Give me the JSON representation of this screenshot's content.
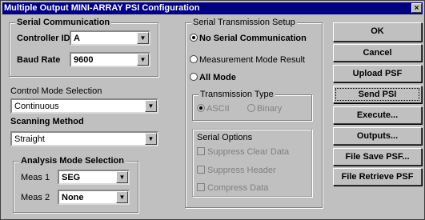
{
  "window": {
    "title": "Multiple Output MINI-ARRAY PSI Configuration",
    "close_glyph": "×"
  },
  "serial_comm": {
    "title": "Serial Communication",
    "controller_id_label": "Controller ID",
    "controller_id_value": "A",
    "baud_rate_label": "Baud Rate",
    "baud_rate_value": "9600"
  },
  "control_mode": {
    "label": "Control Mode Selection",
    "value": "Continuous"
  },
  "scanning": {
    "label": "Scanning Method",
    "value": "Straight"
  },
  "analysis": {
    "title": "Analysis Mode Selection",
    "meas1_label": "Meas 1",
    "meas1_value": "SEG",
    "meas2_label": "Meas 2",
    "meas2_value": "None"
  },
  "serial_tx": {
    "title": "Serial Transmission Setup",
    "options": [
      {
        "label": "No Serial Communication",
        "selected": true
      },
      {
        "label": "Measurement Mode Result",
        "selected": false
      },
      {
        "label": "All Mode",
        "selected": false
      }
    ]
  },
  "tx_type": {
    "title": "Transmission Type",
    "options": [
      {
        "label": "ASCII",
        "selected": true
      },
      {
        "label": "Binary",
        "selected": false
      }
    ]
  },
  "serial_options": {
    "title": "Serial Options",
    "items": [
      {
        "label": "Suppress Clear Data"
      },
      {
        "label": "Suppress Header"
      },
      {
        "label": "Compress Data"
      }
    ]
  },
  "buttons": {
    "ok": "OK",
    "cancel": "Cancel",
    "upload": "Upload PSF",
    "send": "Send PSI",
    "execute": "Execute...",
    "outputs": "Outputs...",
    "file_save": "File Save PSF...",
    "file_retrieve": "File Retrieve PSF"
  }
}
